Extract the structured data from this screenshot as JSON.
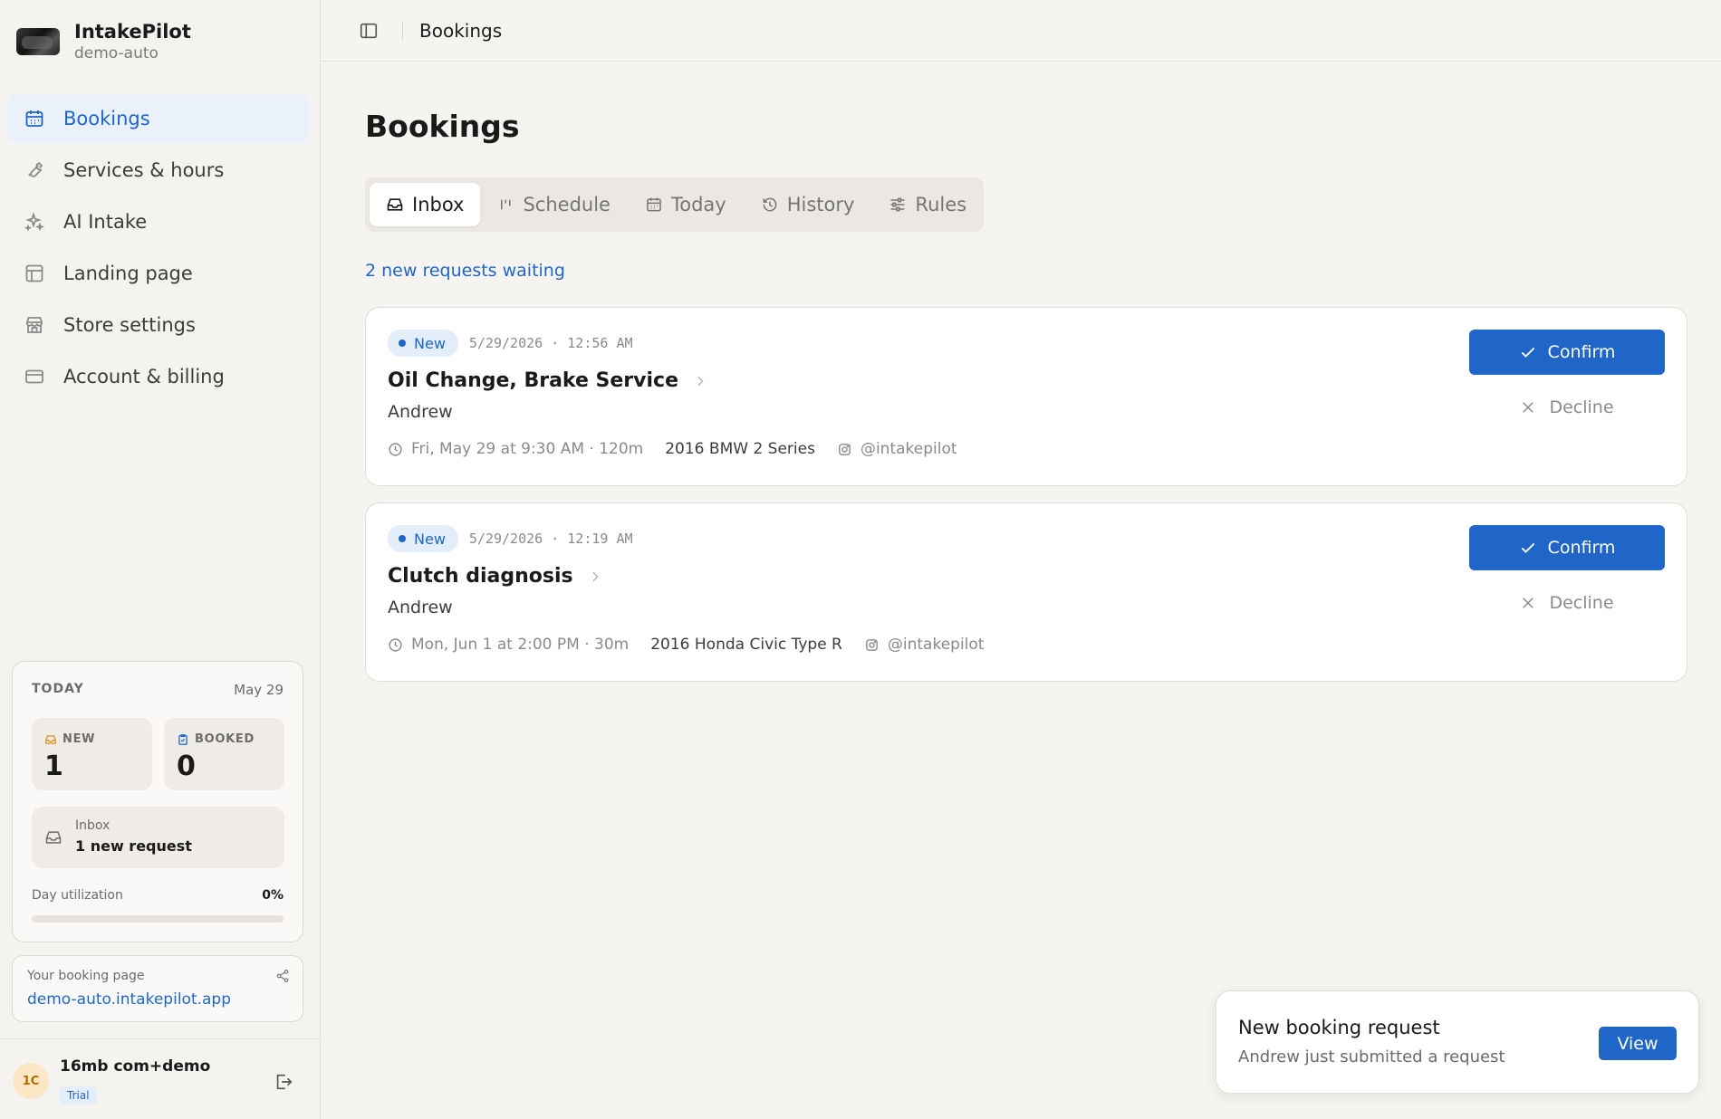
{
  "brand": {
    "name": "IntakePilot",
    "subtitle": "demo-auto"
  },
  "sidebar": {
    "items": [
      {
        "label": "Bookings",
        "icon": "calendar-icon",
        "active": true
      },
      {
        "label": "Services & hours",
        "icon": "wrench-icon"
      },
      {
        "label": "AI Intake",
        "icon": "sparkles-icon"
      },
      {
        "label": "Landing page",
        "icon": "layout-icon"
      },
      {
        "label": "Store settings",
        "icon": "store-icon"
      },
      {
        "label": "Account & billing",
        "icon": "credit-card-icon"
      }
    ]
  },
  "today": {
    "label": "TODAY",
    "date": "May 29",
    "new_label": "NEW",
    "new_value": "1",
    "booked_label": "BOOKED",
    "booked_value": "0",
    "inbox_title": "Inbox",
    "inbox_value": "1 new request",
    "utilization_label": "Day utilization",
    "utilization_value": "0%",
    "utilization_fraction": 0
  },
  "booking_page": {
    "label": "Your booking page",
    "url": "demo-auto.intakepilot.app"
  },
  "user": {
    "initials": "1C",
    "name": "16mb com+demo",
    "plan": "Trial"
  },
  "topbar": {
    "breadcrumb": "Bookings"
  },
  "main": {
    "title": "Bookings",
    "tabs": [
      {
        "label": "Inbox",
        "icon": "inbox-icon",
        "active": true
      },
      {
        "label": "Schedule",
        "icon": "schedule-icon"
      },
      {
        "label": "Today",
        "icon": "calendar-icon"
      },
      {
        "label": "History",
        "icon": "history-icon"
      },
      {
        "label": "Rules",
        "icon": "sliders-icon"
      }
    ],
    "waiting_text": "2 new requests waiting",
    "requests": [
      {
        "badge": "New",
        "submitted": "5/29/2026 · 12:56 AM",
        "title": "Oil Change, Brake Service",
        "customer": "Andrew",
        "appointment": "Fri, May 29 at 9:30 AM · 120m",
        "vehicle": "2016 BMW 2 Series",
        "handle": "@intakepilot",
        "confirm_label": "Confirm",
        "decline_label": "Decline"
      },
      {
        "badge": "New",
        "submitted": "5/29/2026 · 12:19 AM",
        "title": "Clutch diagnosis",
        "customer": "Andrew",
        "appointment": "Mon, Jun 1 at 2:00 PM · 30m",
        "vehicle": "2016 Honda Civic Type R",
        "handle": "@intakepilot",
        "confirm_label": "Confirm",
        "decline_label": "Decline"
      }
    ]
  },
  "toast": {
    "title": "New booking request",
    "description": "Andrew just submitted a request",
    "action_label": "View"
  },
  "colors": {
    "accent": "#1f66c8",
    "active_nav_bg": "#eaf1fb",
    "badge_bg": "#e4eefb",
    "background": "#f6f4f0"
  }
}
